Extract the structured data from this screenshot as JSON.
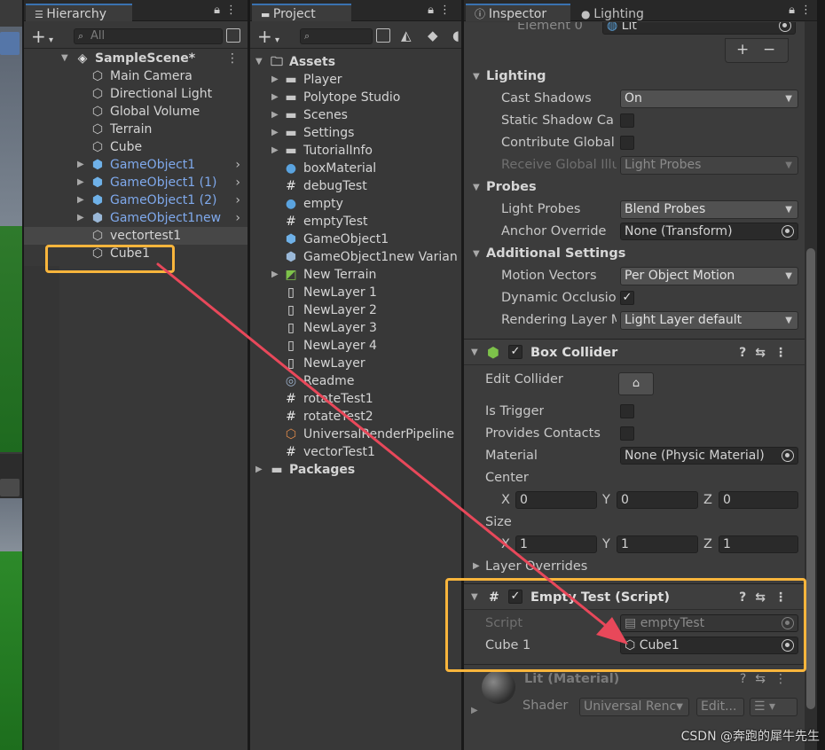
{
  "colors": {
    "highlight_box": "#f8b53c",
    "arrow": "#e8485a",
    "prefab_blue": "#7fa9ec",
    "tab_accent": "#3a72b0"
  },
  "hierarchy": {
    "tab_label": "Hierarchy",
    "search_placeholder": "All",
    "scene_name": "SampleScene*",
    "items": [
      {
        "label": "Main Camera",
        "icon": "cube-outline-icon"
      },
      {
        "label": "Directional Light",
        "icon": "cube-outline-icon"
      },
      {
        "label": "Global Volume",
        "icon": "cube-outline-icon"
      },
      {
        "label": "Terrain",
        "icon": "cube-outline-icon"
      },
      {
        "label": "Cube",
        "icon": "cube-outline-icon"
      },
      {
        "label": "GameObject1",
        "icon": "prefab-cube-icon"
      },
      {
        "label": "GameObject1 (1)",
        "icon": "prefab-cube-icon"
      },
      {
        "label": "GameObject1 (2)",
        "icon": "prefab-cube-icon"
      },
      {
        "label": "GameObject1new",
        "icon": "prefab-variant-icon"
      },
      {
        "label": "vectortest1",
        "icon": "cube-outline-icon"
      },
      {
        "label": "Cube1",
        "icon": "cube-outline-icon"
      }
    ]
  },
  "project": {
    "tab_label": "Project",
    "assets_label": "Assets",
    "packages_label": "Packages",
    "items": [
      {
        "label": "Player",
        "icon": "folder-icon"
      },
      {
        "label": "Polytope Studio",
        "icon": "folder-icon"
      },
      {
        "label": "Scenes",
        "icon": "folder-icon"
      },
      {
        "label": "Settings",
        "icon": "folder-icon"
      },
      {
        "label": "TutorialInfo",
        "icon": "folder-icon"
      },
      {
        "label": "boxMaterial",
        "icon": "material-sphere-icon"
      },
      {
        "label": "debugTest",
        "icon": "script-hash-icon"
      },
      {
        "label": "empty",
        "icon": "material-sphere-icon"
      },
      {
        "label": "emptyTest",
        "icon": "script-hash-icon"
      },
      {
        "label": "GameObject1",
        "icon": "prefab-cube-icon"
      },
      {
        "label": "GameObject1new Varian",
        "icon": "prefab-variant-icon"
      },
      {
        "label": "New Terrain",
        "icon": "terrain-icon"
      },
      {
        "label": "NewLayer 1",
        "icon": "file-icon"
      },
      {
        "label": "NewLayer 2",
        "icon": "file-icon"
      },
      {
        "label": "NewLayer 3",
        "icon": "file-icon"
      },
      {
        "label": "NewLayer 4",
        "icon": "file-icon"
      },
      {
        "label": "NewLayer",
        "icon": "file-icon"
      },
      {
        "label": "Readme",
        "icon": "readme-icon"
      },
      {
        "label": "rotateTest1",
        "icon": "script-hash-icon"
      },
      {
        "label": "rotateTest2",
        "icon": "script-hash-icon"
      },
      {
        "label": "UniversalRenderPipeline",
        "icon": "pipeline-asset-icon"
      },
      {
        "label": "vectorTest1",
        "icon": "script-hash-icon"
      }
    ]
  },
  "inspector": {
    "tab_label": "Inspector",
    "lighting_tab_label": "Lighting",
    "element0_label": "Element 0",
    "element0_value": "Lit",
    "lighting": {
      "title": "Lighting",
      "cast_shadows_label": "Cast Shadows",
      "cast_shadows_value": "On",
      "static_shadow_label": "Static Shadow Ca",
      "contribute_global_label": "Contribute Global",
      "receive_gi_label": "Receive Global Illu",
      "receive_gi_value": "Light Probes"
    },
    "probes": {
      "title": "Probes",
      "light_probes_label": "Light Probes",
      "light_probes_value": "Blend Probes",
      "anchor_label": "Anchor Override",
      "anchor_value": "None (Transform)"
    },
    "additional": {
      "title": "Additional Settings",
      "motion_label": "Motion Vectors",
      "motion_value": "Per Object Motion",
      "dynamic_label": "Dynamic Occlusio",
      "rendering_layer_label": "Rendering Layer M",
      "rendering_layer_value": "Light Layer default"
    },
    "box_collider": {
      "title": "Box Collider",
      "edit_label": "Edit Collider",
      "is_trigger_label": "Is Trigger",
      "provides_contacts_label": "Provides Contacts",
      "material_label": "Material",
      "material_value": "None (Physic Material)",
      "center_label": "Center",
      "size_label": "Size",
      "axis_x": "X",
      "axis_y": "Y",
      "axis_z": "Z",
      "center_x": "0",
      "center_y": "0",
      "center_z": "0",
      "size_x": "1",
      "size_y": "1",
      "size_z": "1",
      "layer_overrides_label": "Layer Overrides"
    },
    "empty_test": {
      "title": "Empty Test (Script)",
      "script_label": "Script",
      "script_value": "emptyTest",
      "cube1_label": "Cube 1",
      "cube1_value": "Cube1"
    },
    "material": {
      "title": "Lit (Material)",
      "shader_label": "Shader",
      "shader_value": "Universal Renc",
      "edit_label": "Edit..."
    }
  },
  "watermark": "CSDN @奔跑的犀牛先生"
}
